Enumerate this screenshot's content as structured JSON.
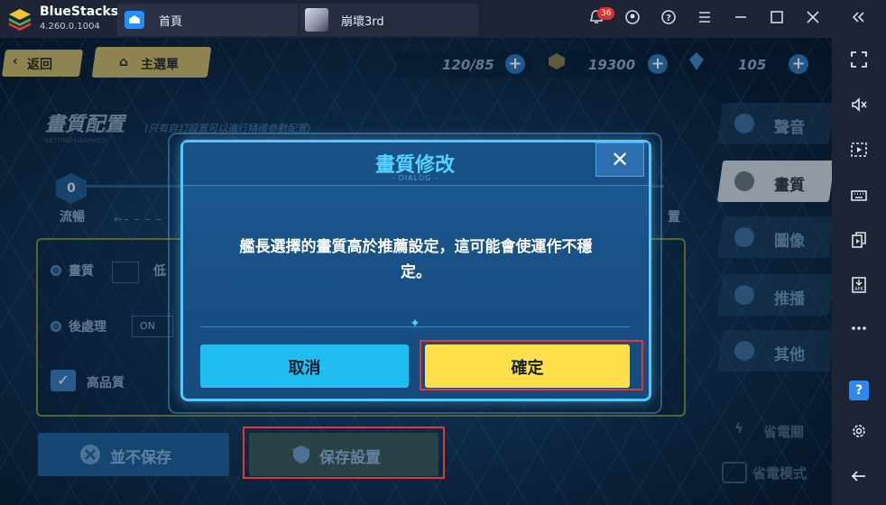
{
  "titlebar": {
    "brand": "BlueStacks",
    "version": "4.260.0.1004",
    "tabs": [
      {
        "label": "首頁"
      },
      {
        "label": "崩壞3rd"
      }
    ],
    "notification_count": "36"
  },
  "game": {
    "nav": {
      "back_label": "返回",
      "main_menu_label": "主選單"
    },
    "resources": [
      {
        "value": "120/85"
      },
      {
        "value": "19300"
      },
      {
        "value": "105"
      }
    ],
    "page_title": "畫質配置",
    "page_subtitle": "(只有自訂設置可以進行精確參數配置)",
    "page_title_en": "SETTING GRAPHICS",
    "slider": {
      "level": "0",
      "left_label": "流暢",
      "right_label": "置"
    },
    "settings": {
      "quality_label": "畫質",
      "quality_value": "低",
      "postprocess_label": "後處理",
      "postprocess_value": "ON",
      "high_quality_label": "高品質"
    },
    "right_tabs": [
      {
        "label": "聲音",
        "active": false
      },
      {
        "label": "畫質",
        "active": true
      },
      {
        "label": "圖像",
        "active": false
      },
      {
        "label": "推播",
        "active": false
      },
      {
        "label": "其他",
        "active": false
      }
    ],
    "bottom": {
      "discard_label": "並不保存",
      "save_label": "保存設置",
      "power_saving_label": "省電關",
      "power_mode_label": "省電模式"
    }
  },
  "dialog": {
    "title": "畫質修改",
    "subtitle": "- DIALOG -",
    "close_symbol": "✕",
    "message_line1": "艦長選擇的畫質高於推薦設定，這可能會使運作不穩",
    "message_line2": "定。",
    "cancel_label": "取消",
    "confirm_label": "確定"
  },
  "icons": {
    "sidebar": [
      "fullscreen-icon",
      "volume-mute-icon",
      "screen-record-icon",
      "keyboard-icon",
      "multi-instance-icon",
      "apk-install-icon",
      "more-icon",
      "help-icon",
      "settings-icon",
      "back-arrow-icon"
    ]
  },
  "colors": {
    "dialog_accent": "#56c6ff",
    "confirm_button": "#ffe04a",
    "cancel_button": "#21bdf2",
    "highlight_box": "#e03838"
  }
}
